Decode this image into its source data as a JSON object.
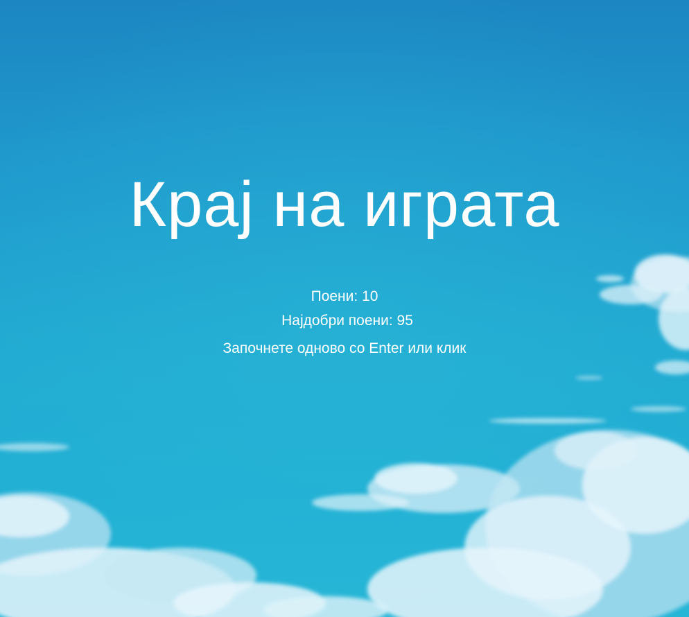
{
  "game_over": {
    "title": "Крај на играта",
    "score_text": "Поени: 10",
    "best_score_text": "Најдобри поени: 95",
    "restart_hint": "Започнете одново со Enter или клик"
  },
  "colors": {
    "sky_top": "#1c86c2",
    "sky_bottom": "#28b6d6",
    "text": "#ffffff",
    "cloud": "#e6f5fb",
    "cloud_shadow": "#a9dcee"
  },
  "background": {
    "icon": "cloudy-sky-background"
  }
}
